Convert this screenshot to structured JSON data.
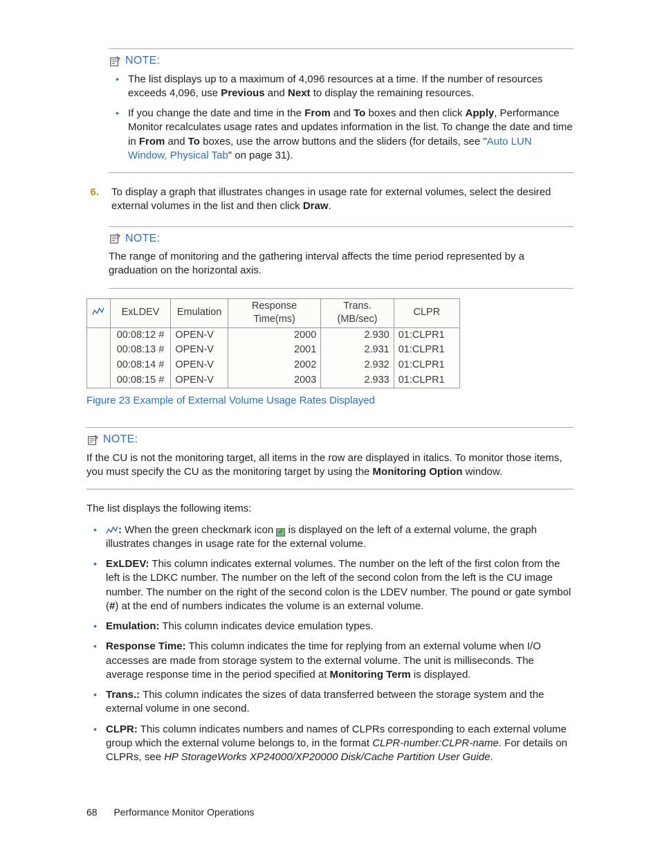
{
  "notes": {
    "label": "NOTE:",
    "note1": {
      "bullet1": {
        "part1": "The list displays up to a maximum of 4,096 resources at a time. If the number of resources exceeds 4,096, use ",
        "b1": "Previous",
        "part2": " and ",
        "b2": "Next",
        "part3": " to display the remaining resources."
      },
      "bullet2": {
        "part1": "If you change the date and time in the ",
        "b1": "From",
        "part2": " and ",
        "b2": "To",
        "part3": " boxes and then click ",
        "b3": "Apply",
        "part4": ", Performance Monitor recalculates usage rates and updates information in the list. To change the date and time in ",
        "b4": "From",
        "part5": " and ",
        "b5": "To",
        "part6": " boxes, use the arrow buttons and the sliders (for details, see \"",
        "link": "Auto LUN Window, Physical Tab",
        "part7": "\" on page 31)."
      }
    },
    "note2": "The range of monitoring and the gathering interval affects the time period represented by a graduation on the horizontal axis.",
    "note3": {
      "p1": "If the CU is not the monitoring target, all items in the row are displayed in italics. To monitor those items, you must specify the CU as the monitoring target by using the ",
      "b1": "Monitoring Option",
      "p2": " window."
    }
  },
  "step6": {
    "num": "6.",
    "p1": "To display a graph that illustrates changes in usage rate for external volumes, select the desired external volumes in the list and then click ",
    "b1": "Draw",
    "p2": "."
  },
  "table": {
    "headers": {
      "icon": "",
      "exldev": "ExLDEV",
      "emulation": "Emulation",
      "response": "Response Time(ms)",
      "trans": "Trans.(MB/sec)",
      "clpr": "CLPR"
    },
    "rows": [
      {
        "exldev": "00:08:12 #",
        "emulation": "OPEN-V",
        "response": "2000",
        "trans": "2.930",
        "clpr": "01:CLPR1"
      },
      {
        "exldev": "00:08:13 #",
        "emulation": "OPEN-V",
        "response": "2001",
        "trans": "2.931",
        "clpr": "01:CLPR1"
      },
      {
        "exldev": "00:08:14 #",
        "emulation": "OPEN-V",
        "response": "2002",
        "trans": "2.932",
        "clpr": "01:CLPR1"
      },
      {
        "exldev": "00:08:15 #",
        "emulation": "OPEN-V",
        "response": "2003",
        "trans": "2.933",
        "clpr": "01:CLPR1"
      }
    ],
    "caption": "Figure 23 Example of External Volume Usage Rates Displayed"
  },
  "list_intro": "The list displays the following items:",
  "list": {
    "i1": {
      "b": ":",
      "t": " When the green checkmark icon ",
      "t2": " is displayed on the left of a external volume, the graph illustrates changes in usage rate for the external volume."
    },
    "i2": {
      "b": "ExLDEV:",
      "t1": " This column indicates external volumes. The number on the left of the first colon from the left is the LDKC number. The number on the left of the second colon from the left is the CU image number. The number on the right of the second colon is the LDEV number. The pound or gate symbol (",
      "b2": "#",
      "t2": ") at the end of numbers indicates the volume is an external volume."
    },
    "i3": {
      "b": "Emulation:",
      "t": " This column indicates device emulation types."
    },
    "i4": {
      "b": "Response Time:",
      "t1": " This column indicates the time for replying from an external volume when I/O accesses are made from storage system to the external volume. The unit is milliseconds. The average response time in the period specified at ",
      "b2": "Monitoring Term",
      "t2": " is displayed."
    },
    "i5": {
      "b": "Trans.:",
      "t": " This column indicates the sizes of data transferred between the storage system and the external volume in one second."
    },
    "i6": {
      "b": "CLPR:",
      "t1": " This column indicates numbers and names of CLPRs corresponding to each external volume group which the external volume belongs to, in the format ",
      "e1": "CLPR-number:CLPR-name",
      "t2": ". For details on CLPRs, see ",
      "e2": "HP StorageWorks XP24000/XP20000 Disk/Cache Partition User Guide",
      "t3": "."
    }
  },
  "footer": {
    "page": "68",
    "title": "Performance Monitor Operations"
  }
}
